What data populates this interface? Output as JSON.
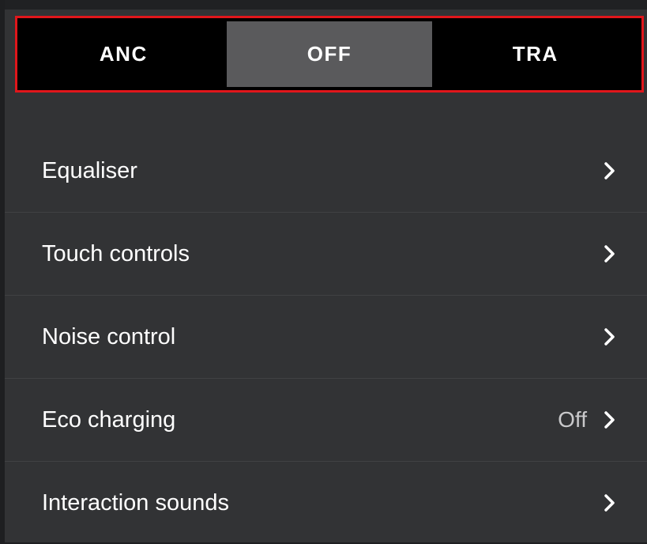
{
  "mode_selector": {
    "options": [
      {
        "label": "ANC",
        "selected": false
      },
      {
        "label": "OFF",
        "selected": true
      },
      {
        "label": "TRA",
        "selected": false
      }
    ]
  },
  "settings": {
    "items": [
      {
        "label": "Equaliser",
        "value": "",
        "icon": "chevron-right-icon"
      },
      {
        "label": "Touch controls",
        "value": "",
        "icon": "chevron-right-icon"
      },
      {
        "label": "Noise control",
        "value": "",
        "icon": "chevron-right-icon"
      },
      {
        "label": "Eco charging",
        "value": "Off",
        "icon": "chevron-right-icon"
      },
      {
        "label": "Interaction sounds",
        "value": "",
        "icon": "chevron-right-icon"
      }
    ]
  },
  "colors": {
    "background": "#323335",
    "selector_background": "#000000",
    "selector_active": "#5a5a5c",
    "highlight_border": "#e0161b",
    "text": "#ffffff"
  }
}
